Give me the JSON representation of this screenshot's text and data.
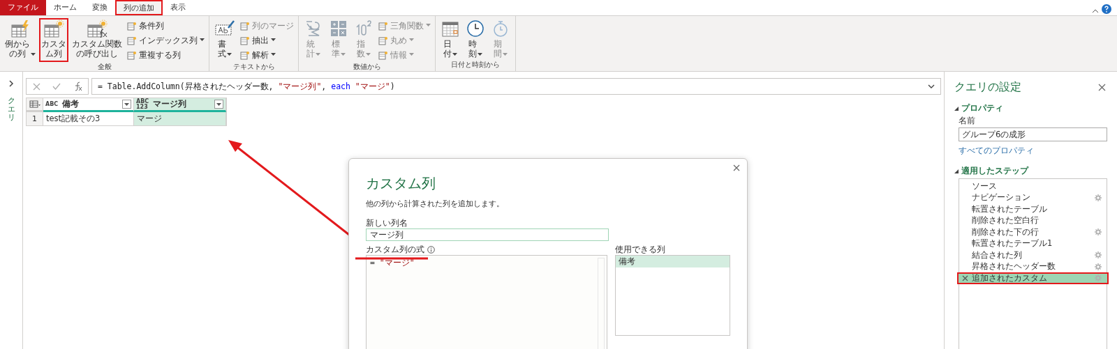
{
  "ribbon_tabs": [
    {
      "label": "ファイル",
      "kind": "file",
      "selected": false,
      "highlighted": false
    },
    {
      "label": "ホーム",
      "kind": "tab",
      "selected": false,
      "highlighted": false
    },
    {
      "label": "変換",
      "kind": "tab",
      "selected": false,
      "highlighted": false
    },
    {
      "label": "列の追加",
      "kind": "tab",
      "selected": true,
      "highlighted": true
    },
    {
      "label": "表示",
      "kind": "tab",
      "selected": false,
      "highlighted": false
    }
  ],
  "ribbon_groups": [
    {
      "label": "全般",
      "big_buttons": [
        {
          "label": "例からの列",
          "dropdown": true,
          "disabled": false,
          "highlighted": false
        },
        {
          "label": "カスタム列",
          "dropdown": false,
          "disabled": false,
          "highlighted": true
        },
        {
          "label": "カスタム関数の呼び出し",
          "dropdown": false,
          "disabled": false,
          "highlighted": false
        }
      ],
      "small_buttons": [
        {
          "label": "条件列",
          "dropdown": false,
          "disabled": false
        },
        {
          "label": "インデックス列",
          "dropdown": true,
          "disabled": false
        },
        {
          "label": "重複する列",
          "dropdown": false,
          "disabled": false
        }
      ]
    },
    {
      "label": "テキストから",
      "big_buttons": [
        {
          "label": "書式",
          "dropdown": true,
          "disabled": false,
          "highlighted": false
        }
      ],
      "small_buttons": [
        {
          "label": "列のマージ",
          "dropdown": false,
          "disabled": true
        },
        {
          "label": "抽出",
          "dropdown": true,
          "disabled": false
        },
        {
          "label": "解析",
          "dropdown": true,
          "disabled": false
        }
      ]
    },
    {
      "label": "数値から",
      "big_buttons": [
        {
          "label": "統計",
          "dropdown": true,
          "disabled": true,
          "highlighted": false
        },
        {
          "label": "標準",
          "dropdown": true,
          "disabled": true,
          "highlighted": false
        },
        {
          "label": "指数",
          "dropdown": true,
          "disabled": true,
          "highlighted": false
        }
      ],
      "small_buttons": [
        {
          "label": "三角関数",
          "dropdown": true,
          "disabled": true
        },
        {
          "label": "丸め",
          "dropdown": true,
          "disabled": true
        },
        {
          "label": "情報",
          "dropdown": true,
          "disabled": true
        }
      ]
    },
    {
      "label": "日付と時刻から",
      "big_buttons": [
        {
          "label": "日付",
          "dropdown": true,
          "disabled": false,
          "highlighted": false
        },
        {
          "label": "時刻",
          "dropdown": true,
          "disabled": false,
          "highlighted": false
        },
        {
          "label": "期間",
          "dropdown": true,
          "disabled": true,
          "highlighted": false
        }
      ]
    }
  ],
  "queries_pane": {
    "label": "クエリ",
    "expanded": false
  },
  "formula_bar": {
    "tokens": [
      {
        "text": "= Table.AddColumn(昇格されたヘッダー数, ",
        "kind": "plain"
      },
      {
        "text": "\"マージ列\"",
        "kind": "string"
      },
      {
        "text": ", ",
        "kind": "plain"
      },
      {
        "text": "each",
        "kind": "keyword"
      },
      {
        "text": "\"マージ\"",
        "kind": "string"
      },
      {
        "text": ")",
        "kind": "plain"
      }
    ]
  },
  "table": {
    "columns": [
      {
        "type": "ABC",
        "name": "備考",
        "selected": false
      },
      {
        "type": "ABC 123",
        "name": "マージ列",
        "selected": true
      }
    ],
    "rows": [
      {
        "number": "1",
        "cells": [
          "test記載その3",
          "マージ"
        ]
      }
    ]
  },
  "dialog": {
    "title": "カスタム列",
    "description": "他の列から計算された列を追加します。",
    "name_label": "新しい列名",
    "name_value": "マージ列",
    "formula_label": "カスタム列の式",
    "formula_tokens": [
      {
        "text": "= ",
        "kind": "plain"
      },
      {
        "text": "\"マージ\"",
        "kind": "string"
      }
    ],
    "available_label": "使用できる列",
    "available_columns": [
      {
        "label": "備考",
        "selected": true
      }
    ]
  },
  "query_settings": {
    "title": "クエリの設定",
    "properties": {
      "heading": "プロパティ",
      "expanded": true,
      "name_label": "名前",
      "name_value": "グループ6の成形",
      "all_properties_link": "すべてのプロパティ"
    },
    "steps": {
      "heading": "適用したステップ",
      "expanded": true,
      "items": [
        {
          "label": "ソース",
          "gear": false,
          "selected": false,
          "highlighted": false
        },
        {
          "label": "ナビゲーション",
          "gear": true,
          "selected": false,
          "highlighted": false
        },
        {
          "label": "転置されたテーブル",
          "gear": false,
          "selected": false,
          "highlighted": false
        },
        {
          "label": "削除された空白行",
          "gear": false,
          "selected": false,
          "highlighted": false
        },
        {
          "label": "削除された下の行",
          "gear": true,
          "selected": false,
          "highlighted": false
        },
        {
          "label": "転置されたテーブル1",
          "gear": false,
          "selected": false,
          "highlighted": false
        },
        {
          "label": "結合された列",
          "gear": true,
          "selected": false,
          "highlighted": false
        },
        {
          "label": "昇格されたヘッダー数",
          "gear": true,
          "selected": false,
          "highlighted": false
        },
        {
          "label": "追加されたカスタム",
          "gear": true,
          "selected": true,
          "highlighted": true
        }
      ]
    }
  }
}
